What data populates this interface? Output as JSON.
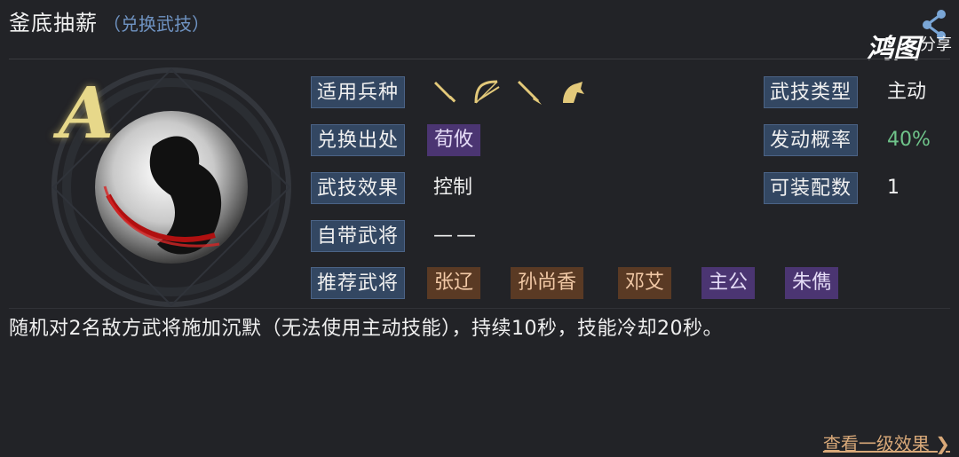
{
  "header": {
    "title": "釜底抽薪",
    "subtitle": "（兑换武技）",
    "share_label": "分享",
    "brand": "鸿图"
  },
  "skill": {
    "grade": "A",
    "rows": {
      "unit_types_label": "适用兵种",
      "exchange_source_label": "兑换出处",
      "exchange_source_value": "荀攸",
      "effect_label": "武技效果",
      "effect_value": "控制",
      "own_general_label": "自带武将",
      "own_general_value": "——",
      "recommended_label": "推荐武将",
      "recommended": [
        "张辽",
        "孙尚香",
        "邓艾",
        "主公",
        "朱儁"
      ],
      "skill_type_label": "武技类型",
      "skill_type_value": "主动",
      "trigger_rate_label": "发动概率",
      "trigger_rate_value": "40%",
      "equip_count_label": "可装配数",
      "equip_count_value": "1"
    },
    "unit_icons": [
      "sword-icon",
      "bow-icon",
      "spear-icon",
      "horse-icon"
    ]
  },
  "description": "随机对2名敌方武将施加沉默（无法使用主动技能），持续10秒，技能冷却20秒。",
  "footer": {
    "more_label": "查看一级效果 ❯"
  },
  "colors": {
    "accent_gold": "#e7d88a",
    "label_bg": "#334762",
    "purple": "#4b3572",
    "brown": "#5a3a24",
    "green": "#6fc48a"
  }
}
